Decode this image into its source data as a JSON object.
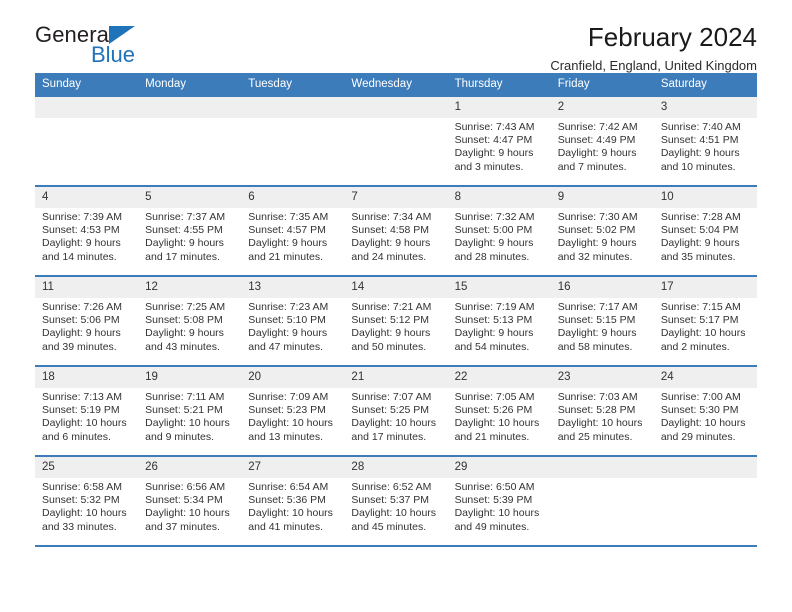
{
  "brand": {
    "name_top": "General",
    "name_bottom": "Blue",
    "triangle_color": "#1f73b8"
  },
  "header": {
    "title": "February 2024",
    "subtitle": "Cranfield, England, United Kingdom",
    "accent_color": "#3d7cba",
    "shade_color": "#efefef"
  },
  "calendar": {
    "weekdays": [
      "Sunday",
      "Monday",
      "Tuesday",
      "Wednesday",
      "Thursday",
      "Friday",
      "Saturday"
    ],
    "weeks": [
      [
        {
          "day": "",
          "sunrise": "",
          "sunset": "",
          "daylight1": "",
          "daylight2": "",
          "shaded": true
        },
        {
          "day": "",
          "sunrise": "",
          "sunset": "",
          "daylight1": "",
          "daylight2": "",
          "shaded": true
        },
        {
          "day": "",
          "sunrise": "",
          "sunset": "",
          "daylight1": "",
          "daylight2": "",
          "shaded": true
        },
        {
          "day": "",
          "sunrise": "",
          "sunset": "",
          "daylight1": "",
          "daylight2": "",
          "shaded": true
        },
        {
          "day": "1",
          "sunrise": "Sunrise: 7:43 AM",
          "sunset": "Sunset: 4:47 PM",
          "daylight1": "Daylight: 9 hours",
          "daylight2": "and 3 minutes.",
          "shaded": true
        },
        {
          "day": "2",
          "sunrise": "Sunrise: 7:42 AM",
          "sunset": "Sunset: 4:49 PM",
          "daylight1": "Daylight: 9 hours",
          "daylight2": "and 7 minutes.",
          "shaded": true
        },
        {
          "day": "3",
          "sunrise": "Sunrise: 7:40 AM",
          "sunset": "Sunset: 4:51 PM",
          "daylight1": "Daylight: 9 hours",
          "daylight2": "and 10 minutes.",
          "shaded": true
        }
      ],
      [
        {
          "day": "4",
          "sunrise": "Sunrise: 7:39 AM",
          "sunset": "Sunset: 4:53 PM",
          "daylight1": "Daylight: 9 hours",
          "daylight2": "and 14 minutes.",
          "shaded": true
        },
        {
          "day": "5",
          "sunrise": "Sunrise: 7:37 AM",
          "sunset": "Sunset: 4:55 PM",
          "daylight1": "Daylight: 9 hours",
          "daylight2": "and 17 minutes.",
          "shaded": true
        },
        {
          "day": "6",
          "sunrise": "Sunrise: 7:35 AM",
          "sunset": "Sunset: 4:57 PM",
          "daylight1": "Daylight: 9 hours",
          "daylight2": "and 21 minutes.",
          "shaded": true
        },
        {
          "day": "7",
          "sunrise": "Sunrise: 7:34 AM",
          "sunset": "Sunset: 4:58 PM",
          "daylight1": "Daylight: 9 hours",
          "daylight2": "and 24 minutes.",
          "shaded": true
        },
        {
          "day": "8",
          "sunrise": "Sunrise: 7:32 AM",
          "sunset": "Sunset: 5:00 PM",
          "daylight1": "Daylight: 9 hours",
          "daylight2": "and 28 minutes.",
          "shaded": true
        },
        {
          "day": "9",
          "sunrise": "Sunrise: 7:30 AM",
          "sunset": "Sunset: 5:02 PM",
          "daylight1": "Daylight: 9 hours",
          "daylight2": "and 32 minutes.",
          "shaded": true
        },
        {
          "day": "10",
          "sunrise": "Sunrise: 7:28 AM",
          "sunset": "Sunset: 5:04 PM",
          "daylight1": "Daylight: 9 hours",
          "daylight2": "and 35 minutes.",
          "shaded": true
        }
      ],
      [
        {
          "day": "11",
          "sunrise": "Sunrise: 7:26 AM",
          "sunset": "Sunset: 5:06 PM",
          "daylight1": "Daylight: 9 hours",
          "daylight2": "and 39 minutes.",
          "shaded": true
        },
        {
          "day": "12",
          "sunrise": "Sunrise: 7:25 AM",
          "sunset": "Sunset: 5:08 PM",
          "daylight1": "Daylight: 9 hours",
          "daylight2": "and 43 minutes.",
          "shaded": true
        },
        {
          "day": "13",
          "sunrise": "Sunrise: 7:23 AM",
          "sunset": "Sunset: 5:10 PM",
          "daylight1": "Daylight: 9 hours",
          "daylight2": "and 47 minutes.",
          "shaded": true
        },
        {
          "day": "14",
          "sunrise": "Sunrise: 7:21 AM",
          "sunset": "Sunset: 5:12 PM",
          "daylight1": "Daylight: 9 hours",
          "daylight2": "and 50 minutes.",
          "shaded": true
        },
        {
          "day": "15",
          "sunrise": "Sunrise: 7:19 AM",
          "sunset": "Sunset: 5:13 PM",
          "daylight1": "Daylight: 9 hours",
          "daylight2": "and 54 minutes.",
          "shaded": true
        },
        {
          "day": "16",
          "sunrise": "Sunrise: 7:17 AM",
          "sunset": "Sunset: 5:15 PM",
          "daylight1": "Daylight: 9 hours",
          "daylight2": "and 58 minutes.",
          "shaded": true
        },
        {
          "day": "17",
          "sunrise": "Sunrise: 7:15 AM",
          "sunset": "Sunset: 5:17 PM",
          "daylight1": "Daylight: 10 hours",
          "daylight2": "and 2 minutes.",
          "shaded": true
        }
      ],
      [
        {
          "day": "18",
          "sunrise": "Sunrise: 7:13 AM",
          "sunset": "Sunset: 5:19 PM",
          "daylight1": "Daylight: 10 hours",
          "daylight2": "and 6 minutes.",
          "shaded": true
        },
        {
          "day": "19",
          "sunrise": "Sunrise: 7:11 AM",
          "sunset": "Sunset: 5:21 PM",
          "daylight1": "Daylight: 10 hours",
          "daylight2": "and 9 minutes.",
          "shaded": true
        },
        {
          "day": "20",
          "sunrise": "Sunrise: 7:09 AM",
          "sunset": "Sunset: 5:23 PM",
          "daylight1": "Daylight: 10 hours",
          "daylight2": "and 13 minutes.",
          "shaded": true
        },
        {
          "day": "21",
          "sunrise": "Sunrise: 7:07 AM",
          "sunset": "Sunset: 5:25 PM",
          "daylight1": "Daylight: 10 hours",
          "daylight2": "and 17 minutes.",
          "shaded": true
        },
        {
          "day": "22",
          "sunrise": "Sunrise: 7:05 AM",
          "sunset": "Sunset: 5:26 PM",
          "daylight1": "Daylight: 10 hours",
          "daylight2": "and 21 minutes.",
          "shaded": true
        },
        {
          "day": "23",
          "sunrise": "Sunrise: 7:03 AM",
          "sunset": "Sunset: 5:28 PM",
          "daylight1": "Daylight: 10 hours",
          "daylight2": "and 25 minutes.",
          "shaded": true
        },
        {
          "day": "24",
          "sunrise": "Sunrise: 7:00 AM",
          "sunset": "Sunset: 5:30 PM",
          "daylight1": "Daylight: 10 hours",
          "daylight2": "and 29 minutes.",
          "shaded": true
        }
      ],
      [
        {
          "day": "25",
          "sunrise": "Sunrise: 6:58 AM",
          "sunset": "Sunset: 5:32 PM",
          "daylight1": "Daylight: 10 hours",
          "daylight2": "and 33 minutes.",
          "shaded": true
        },
        {
          "day": "26",
          "sunrise": "Sunrise: 6:56 AM",
          "sunset": "Sunset: 5:34 PM",
          "daylight1": "Daylight: 10 hours",
          "daylight2": "and 37 minutes.",
          "shaded": true
        },
        {
          "day": "27",
          "sunrise": "Sunrise: 6:54 AM",
          "sunset": "Sunset: 5:36 PM",
          "daylight1": "Daylight: 10 hours",
          "daylight2": "and 41 minutes.",
          "shaded": true
        },
        {
          "day": "28",
          "sunrise": "Sunrise: 6:52 AM",
          "sunset": "Sunset: 5:37 PM",
          "daylight1": "Daylight: 10 hours",
          "daylight2": "and 45 minutes.",
          "shaded": true
        },
        {
          "day": "29",
          "sunrise": "Sunrise: 6:50 AM",
          "sunset": "Sunset: 5:39 PM",
          "daylight1": "Daylight: 10 hours",
          "daylight2": "and 49 minutes.",
          "shaded": true
        },
        {
          "day": "",
          "sunrise": "",
          "sunset": "",
          "daylight1": "",
          "daylight2": "",
          "shaded": true
        },
        {
          "day": "",
          "sunrise": "",
          "sunset": "",
          "daylight1": "",
          "daylight2": "",
          "shaded": true
        }
      ]
    ]
  }
}
